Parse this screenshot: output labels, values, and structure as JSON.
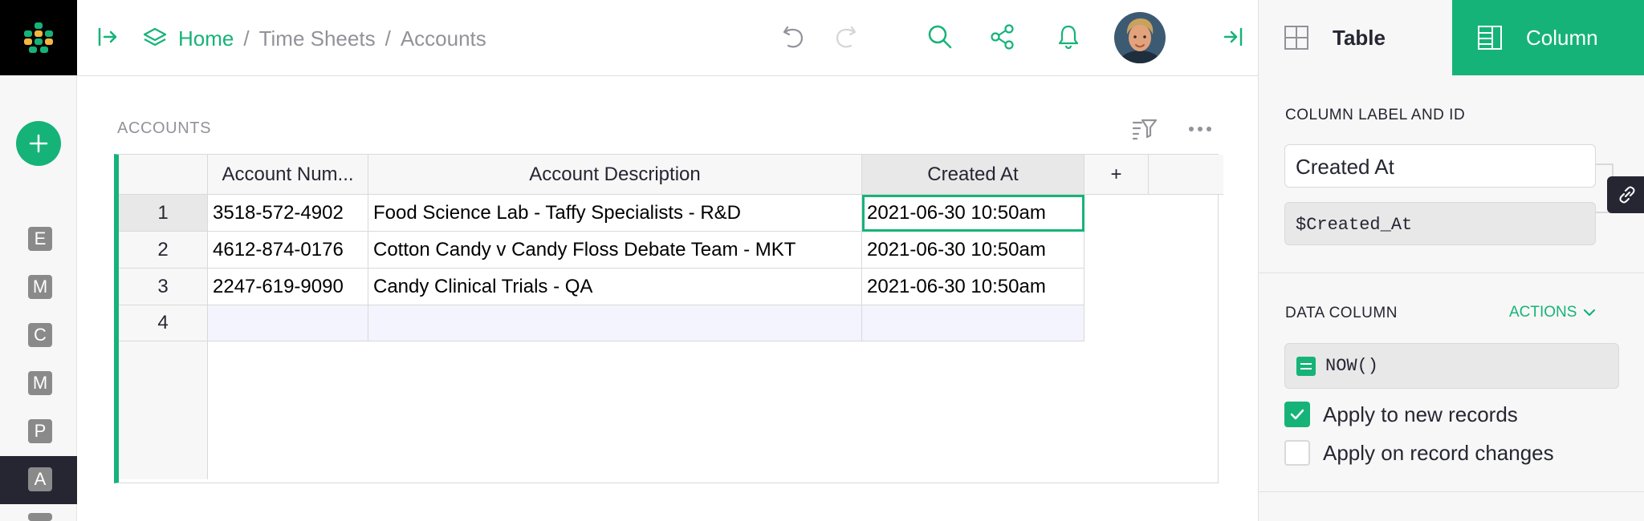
{
  "breadcrumb": {
    "home": "Home",
    "sep1": "/",
    "level2": "Time Sheets",
    "sep2": "/",
    "current": "Accounts"
  },
  "rail": {
    "pages": [
      "E",
      "M",
      "C",
      "M",
      "P",
      "A"
    ],
    "active_index": 5
  },
  "section": {
    "title": "ACCOUNTS"
  },
  "grid": {
    "columns": [
      "Account Num...",
      "Account Description",
      "Created At"
    ],
    "add_column": "+",
    "rows": [
      {
        "num": "1",
        "cells": [
          "3518-572-4902",
          "Food Science Lab - Taffy Specialists - R&D",
          "2021-06-30 10:50am"
        ]
      },
      {
        "num": "2",
        "cells": [
          "4612-874-0176",
          "Cotton Candy v Candy Floss Debate Team - MKT",
          "2021-06-30 10:50am"
        ]
      },
      {
        "num": "3",
        "cells": [
          "2247-619-9090",
          "Candy Clinical Trials - QA",
          "2021-06-30 10:50am"
        ]
      }
    ],
    "new_row_num": "4"
  },
  "right_panel": {
    "tab_table": "Table",
    "tab_column": "Column",
    "label_section": "COLUMN LABEL AND ID",
    "label_value": "Created At",
    "id_value": "$Created_At",
    "data_column_section": "DATA COLUMN",
    "actions_label": "ACTIONS",
    "formula": "NOW()",
    "apply_new": "Apply to new records",
    "apply_new_checked": true,
    "apply_changes": "Apply on record changes",
    "apply_changes_checked": false
  },
  "colors": {
    "accent": "#16b378",
    "dark": "#262633",
    "muted": "#929299"
  }
}
